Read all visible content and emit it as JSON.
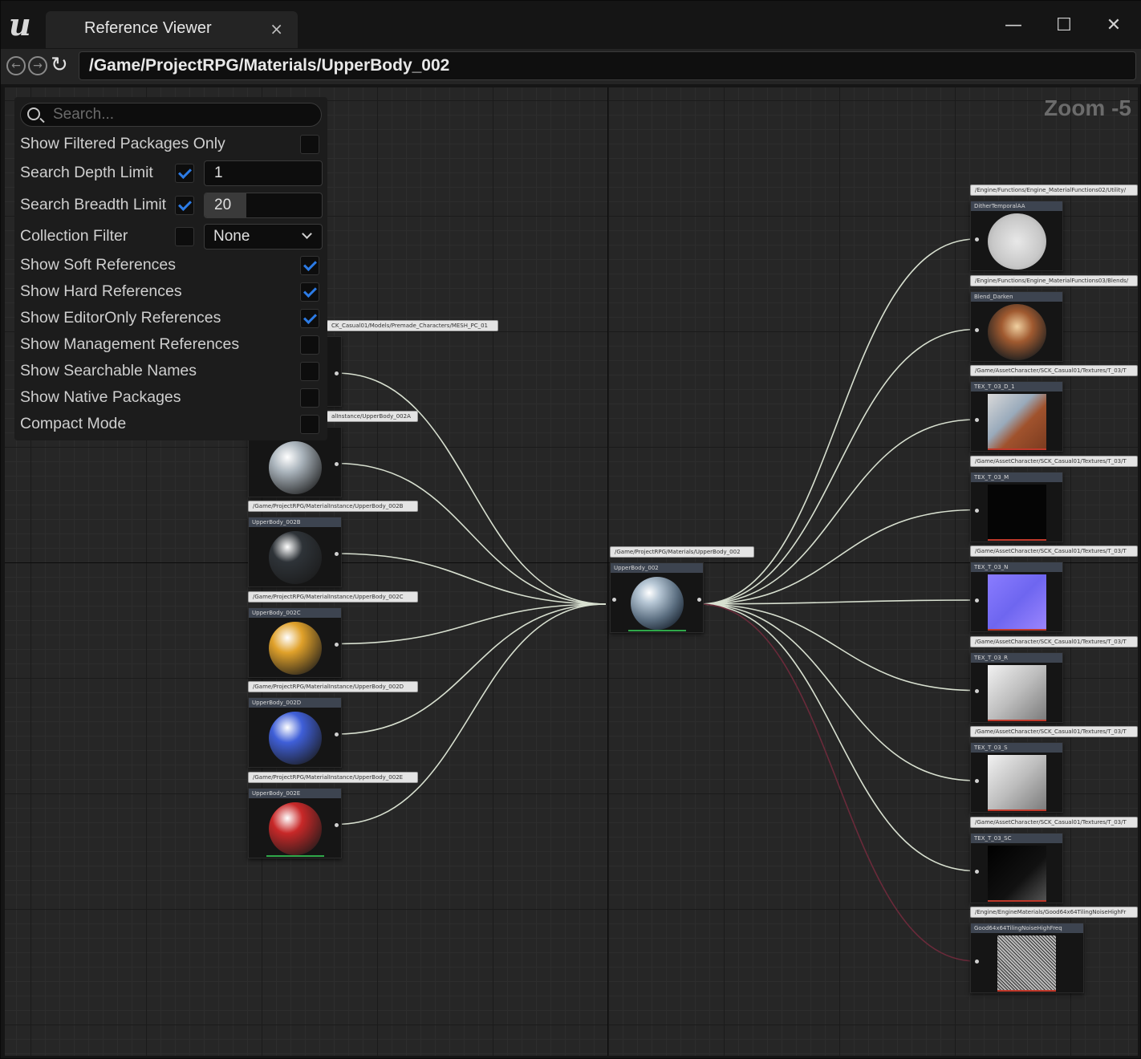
{
  "window": {
    "tab_title": "Reference Viewer",
    "close_glyph": "×",
    "minimize_glyph": "—",
    "maximize_glyph": "☐",
    "window_close_glyph": "✕"
  },
  "toolbar": {
    "back_glyph": "←",
    "forward_glyph": "→",
    "refresh_glyph": "↻",
    "address": "/Game/ProjectRPG/Materials/UpperBody_002"
  },
  "graph": {
    "zoom_label": "Zoom -5"
  },
  "settings": {
    "search_placeholder": "Search...",
    "show_filtered_packages_only": {
      "label": "Show Filtered Packages Only",
      "checked": false
    },
    "search_depth_limit": {
      "label": "Search Depth Limit",
      "checked": true,
      "value": "1"
    },
    "search_breadth_limit": {
      "label": "Search Breadth Limit",
      "checked": true,
      "value": "20"
    },
    "collection_filter": {
      "label": "Collection Filter",
      "checked": false,
      "value": "None"
    },
    "show_soft_references": {
      "label": "Show Soft References",
      "checked": true
    },
    "show_hard_references": {
      "label": "Show Hard References",
      "checked": true
    },
    "show_editoronly_references": {
      "label": "Show EditorOnly References",
      "checked": true
    },
    "show_management_references": {
      "label": "Show Management References",
      "checked": false
    },
    "show_searchable_names": {
      "label": "Show Searchable Names",
      "checked": false
    },
    "show_native_packages": {
      "label": "Show Native Packages",
      "checked": false
    },
    "compact_mode": {
      "label": "Compact Mode",
      "checked": false
    }
  },
  "center_node": {
    "path": "/Game/ProjectRPG/Materials/UpperBody_002",
    "title": "UpperBody_002"
  },
  "referencers": [
    {
      "path": "CK_Casual01/Models/Premade_Characters/MESH_PC_01",
      "title": "",
      "color": "#9aa4ad"
    },
    {
      "path": "alInstance/UpperBody_002A",
      "title": "",
      "color": "#aab4bc"
    },
    {
      "path": "/Game/ProjectRPG/MaterialInstance/UpperBody_002B",
      "title": "UpperBody_002B",
      "color": "#2e3338"
    },
    {
      "path": "/Game/ProjectRPG/MaterialInstance/UpperBody_002C",
      "title": "UpperBody_002C",
      "color": "#e0a12a"
    },
    {
      "path": "/Game/ProjectRPG/MaterialInstance/UpperBody_002D",
      "title": "UpperBody_002D",
      "color": "#3f5fd8"
    },
    {
      "path": "/Game/ProjectRPG/MaterialInstance/UpperBody_002E",
      "title": "UpperBody_002E",
      "color": "#c82828"
    }
  ],
  "dependencies": [
    {
      "path": "/Engine/Functions/Engine_MaterialFunctions02/Utility/",
      "title": "DitherTemporalAA"
    },
    {
      "path": "/Engine/Functions/Engine_MaterialFunctions03/Blends/",
      "title": "Blend_Darken"
    },
    {
      "path": "/Game/AssetCharacter/SCK_Casual01/Textures/T_03/T",
      "title": "TEX_T_03_D_1"
    },
    {
      "path": "/Game/AssetCharacter/SCK_Casual01/Textures/T_03/T",
      "title": "TEX_T_03_M"
    },
    {
      "path": "/Game/AssetCharacter/SCK_Casual01/Textures/T_03/T",
      "title": "TEX_T_03_N"
    },
    {
      "path": "/Game/AssetCharacter/SCK_Casual01/Textures/T_03/T",
      "title": "TEX_T_03_R"
    },
    {
      "path": "/Game/AssetCharacter/SCK_Casual01/Textures/T_03/T",
      "title": "TEX_T_03_S"
    },
    {
      "path": "/Game/AssetCharacter/SCK_Casual01/Textures/T_03/T",
      "title": "TEX_T_03_SC"
    },
    {
      "path": "/Engine/EngineMaterials/Good64x64TilingNoiseHighFr",
      "title": "Good64x64TilingNoiseHighFreq"
    }
  ]
}
